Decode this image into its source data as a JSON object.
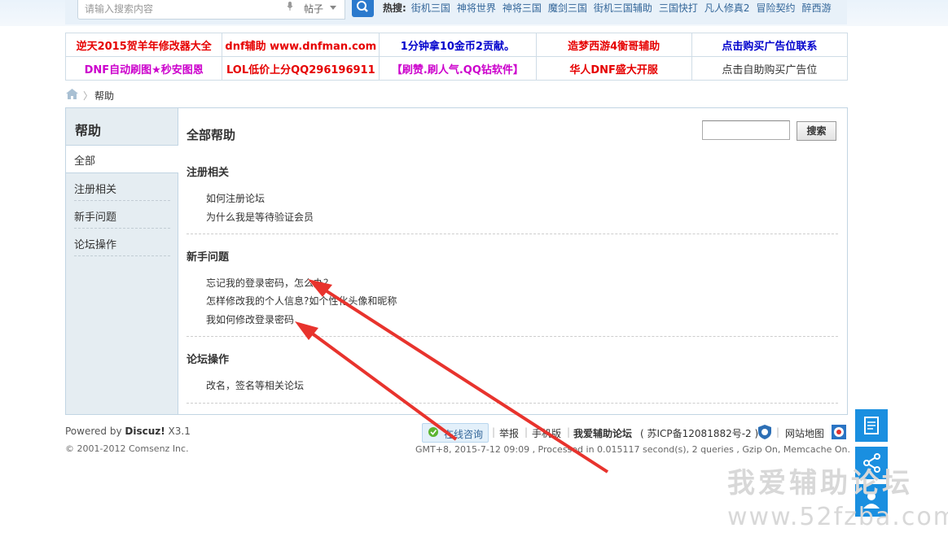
{
  "topbar": {
    "search_placeholder": "请输入搜索内容",
    "search_type": "帖子",
    "hot_label": "热搜:",
    "hot_links": [
      "街机三国",
      "神将世界",
      "神将三国",
      "魔剑三国",
      "街机三国辅助",
      "三国快打",
      "凡人修真2",
      "冒险契约",
      "醉西游"
    ]
  },
  "ads": [
    [
      {
        "text": "逆天2015贺羊年修改器大全",
        "color": "#e60000"
      },
      {
        "text": "dnf辅助 www.dnfman.com",
        "color": "#e60000"
      },
      {
        "text": "1分钟拿10金币2贡献。",
        "color": "#0000cc"
      },
      {
        "text": "造梦西游4衡哥辅助",
        "color": "#e60000"
      },
      {
        "text": "点击购买广告位联系",
        "color": "#0000cc"
      }
    ],
    [
      {
        "text": "DNF自动刷图★秒安图恩",
        "color": "#cc00cc"
      },
      {
        "text": "LOL低价上分QQ296196911",
        "color": "#e60000"
      },
      {
        "text": "【刷赞.刷人气.QQ钻软件】",
        "color": "#cc00cc"
      },
      {
        "text": "华人DNF盛大开服",
        "color": "#e60000"
      },
      {
        "text": "点击自助购买广告位",
        "color": "#333333"
      }
    ]
  ],
  "breadcrumb": {
    "sep": "〉",
    "current": "帮助"
  },
  "sidebar": {
    "title": "帮助",
    "items": [
      {
        "label": "全部"
      },
      {
        "label": "注册相关"
      },
      {
        "label": "新手问题"
      },
      {
        "label": "论坛操作"
      }
    ]
  },
  "content": {
    "title": "全部帮助",
    "search_button": "搜索",
    "sections": [
      {
        "title": "注册相关",
        "links": [
          "如何注册论坛",
          "为什么我是等待验证会员"
        ]
      },
      {
        "title": "新手问题",
        "links": [
          "忘记我的登录密码，怎么办？",
          "怎样修改我的个人信息?如个性化头像和昵称",
          "我如何修改登录密码"
        ]
      },
      {
        "title": "论坛操作",
        "links": [
          "改名，签名等相关论坛"
        ]
      }
    ]
  },
  "footer": {
    "powered_prefix": "Powered by ",
    "powered_brand": "Discuz!",
    "powered_version": " X3.1",
    "copyright": "© 2001-2012 Comsenz Inc.",
    "online": "在线咨询",
    "report": "举报",
    "mobile": "手机版",
    "site_name": "我爱辅助论坛",
    "icp": "( 苏ICP备12081882号-2 )",
    "sitemap": "网站地图",
    "sep": "|",
    "stats": "GMT+8, 2015-7-12 09:09 , Processed in 0.015117 second(s), 2 queries , Gzip On, Memcache On."
  },
  "watermark": {
    "line1": "我爱辅助论坛",
    "line2": "www.52fzba.com"
  },
  "colors": {
    "accent": "#2b7acd",
    "float_buttons": "#1a8fe0",
    "annotation_arrow": "#e8332d"
  }
}
